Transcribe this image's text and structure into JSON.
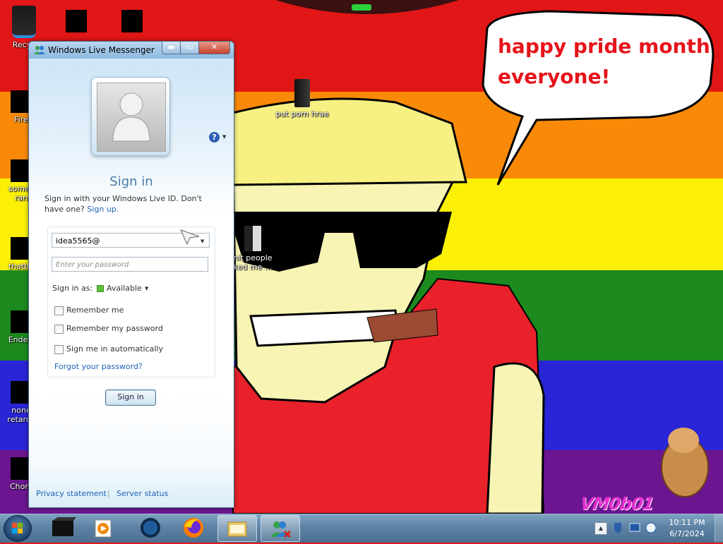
{
  "desktop": {
    "speech_bubble_line1": "happy pride month",
    "speech_bubble_line2": "everyone!",
    "watermark": "VM0b01",
    "icons": [
      {
        "label": "Recyc"
      },
      {
        "label": "Fire"
      },
      {
        "label": "some i"
      },
      {
        "label": "ran"
      },
      {
        "label": "thatbu"
      },
      {
        "label": "Enderr"
      },
      {
        "label": "none"
      },
      {
        "label": "retards"
      },
      {
        "label": "Chom"
      },
      {
        "label": "put porn hrae"
      },
      {
        "label": "nit people"
      },
      {
        "label": "ked me ..."
      }
    ]
  },
  "window": {
    "title": "Windows Live Messenger",
    "minimize": "▬",
    "maximize": "▭",
    "close": "✕"
  },
  "signin": {
    "heading": "Sign in",
    "description": "Sign in with your Windows Live ID. Don't have one?",
    "signup_link": "Sign up.",
    "id_value": "idea5565@",
    "password_placeholder": "Enter your password",
    "status_label": "Sign in as:",
    "status_value": "Available",
    "remember_me": "Remember me",
    "remember_password": "Remember my password",
    "auto_signin": "Sign me in automatically",
    "forgot_password": "Forgot your password?",
    "button": "Sign in",
    "help": "?"
  },
  "footer": {
    "privacy": "Privacy statement",
    "server_status": "Server status"
  },
  "taskbar": {
    "time": "10:11 PM",
    "date": "6/7/2024",
    "items": [
      "cmd-window",
      "media-player",
      "network-app",
      "firefox",
      "explorer",
      "messenger"
    ]
  },
  "colors": {
    "link": "#1d62b8",
    "bubble_text": "#e6141b",
    "available": "#5cc13c"
  }
}
